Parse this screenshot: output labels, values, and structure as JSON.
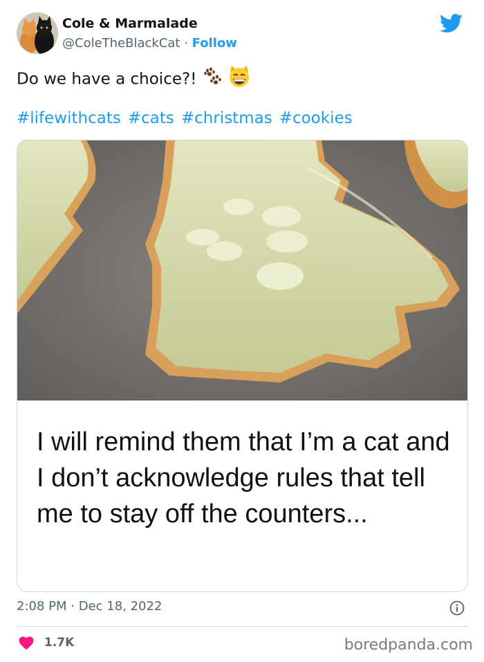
{
  "tweet": {
    "display_name": "Cole & Marmalade",
    "handle": "@ColeTheBlackCat",
    "separator": " · ",
    "follow_label": "Follow",
    "text": "Do we have a choice?!",
    "emojis": [
      "paw-prints-icon",
      "grinning-cat-icon"
    ],
    "hashtags": [
      "#lifewithcats",
      "#cats",
      "#christmas",
      "#cookies"
    ],
    "image_caption": "I will remind them that I’m a cat and I don’t acknowledge rules that tell me to stay off the counters...",
    "time": "2:08 PM",
    "date_separator": " · ",
    "date": "Dec 18, 2022",
    "likes": "1.7K"
  },
  "watermark": "boredpanda.com",
  "colors": {
    "accent": "#1d9bf0",
    "like": "#f91880",
    "muted": "#536471",
    "border": "#cfd9de"
  }
}
